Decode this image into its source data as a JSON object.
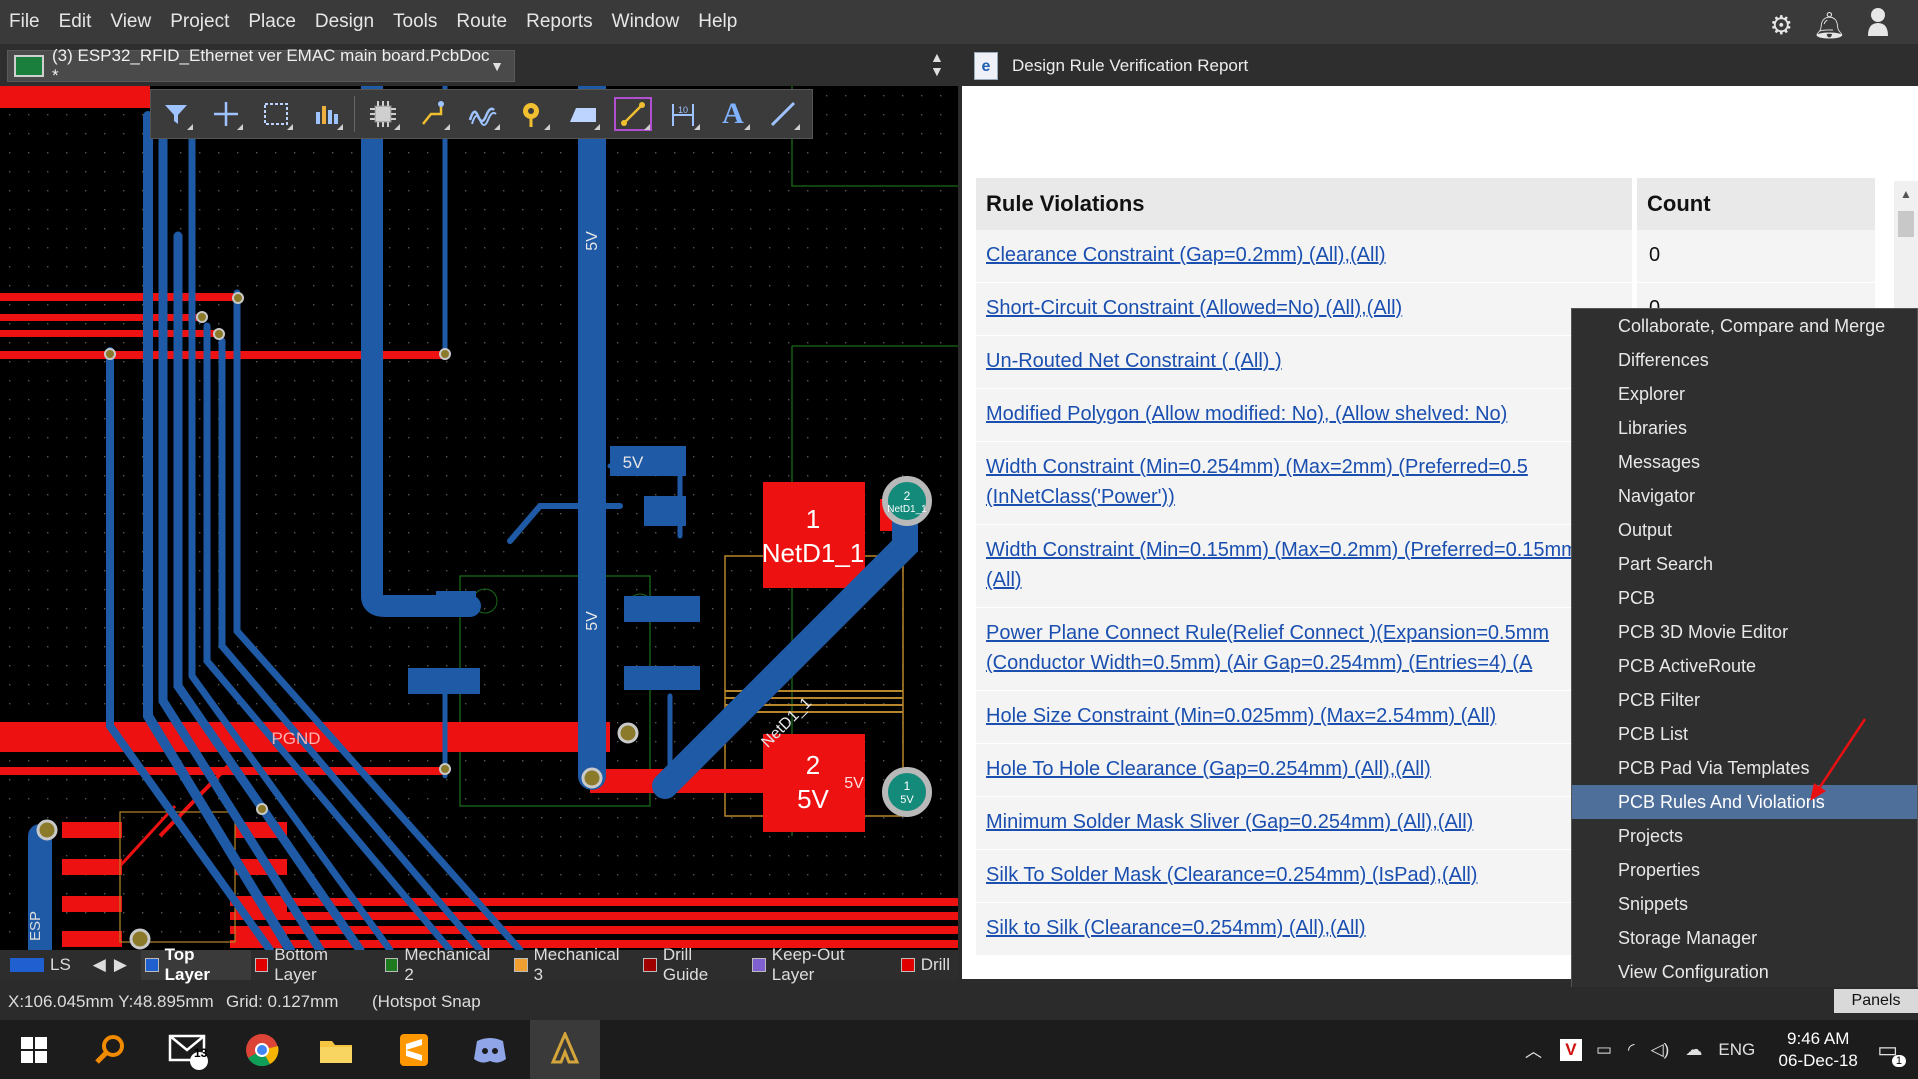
{
  "menubar": {
    "items": [
      "File",
      "Edit",
      "View",
      "Project",
      "Place",
      "Design",
      "Tools",
      "Route",
      "Reports",
      "Window",
      "Help"
    ]
  },
  "top_right_icons": [
    "gear-icon",
    "bell-icon",
    "user-icon"
  ],
  "doc_tab": {
    "title": "(3) ESP32_RFID_Ethernet ver EMAC main board.PcbDoc *"
  },
  "report_tab": {
    "title": "Design Rule Verification Report"
  },
  "pcb": {
    "labels": {
      "five_v_1": "5V",
      "five_v_2": "5V",
      "five_v_3": "5V",
      "pad1_num": "1",
      "pad1_net": "NetD1_1",
      "pad2_num": "2",
      "pad2_net": "5V",
      "via1_num": "2",
      "via1_net": "NetD1_1",
      "via2_num": "1",
      "via2_net": "5V",
      "trace_net": "NetD1_1",
      "pgnd": "PGND",
      "five_v_side": "5V",
      "esp": "ESP"
    }
  },
  "toolbar": {
    "tools": [
      "filter-icon",
      "cross-probe-icon",
      "select-region-icon",
      "chart-icon",
      "component-icon",
      "route-icon",
      "diff-pair-icon",
      "pad-via-icon",
      "polygon-icon",
      "interactive-length-icon",
      "dimension-icon",
      "text-icon",
      "line-icon"
    ]
  },
  "report": {
    "headers": {
      "rule": "Rule Violations",
      "count": "Count"
    },
    "rows": [
      {
        "rule": "Clearance Constraint (Gap=0.2mm) (All),(All)",
        "count": "0"
      },
      {
        "rule": "Short-Circuit Constraint (Allowed=No) (All),(All)",
        "count": "0"
      },
      {
        "rule": "Un-Routed Net Constraint ( (All) )",
        "count": ""
      },
      {
        "rule": "Modified Polygon (Allow modified: No), (Allow shelved: No)",
        "count": ""
      },
      {
        "rule": "Width Constraint (Min=0.254mm) (Max=2mm) (Preferred=0.5 (InNetClass('Power'))",
        "count": ""
      },
      {
        "rule": "Width Constraint (Min=0.15mm) (Max=0.2mm) (Preferred=0.15mm) (All)",
        "count": ""
      },
      {
        "rule": "Power Plane Connect Rule(Relief Connect )(Expansion=0.5mm (Conductor Width=0.5mm) (Air Gap=0.254mm) (Entries=4) (A",
        "count": ""
      },
      {
        "rule": "Hole Size Constraint (Min=0.025mm) (Max=2.54mm) (All)",
        "count": ""
      },
      {
        "rule": "Hole To Hole Clearance (Gap=0.254mm) (All),(All)",
        "count": ""
      },
      {
        "rule": "Minimum Solder Mask Sliver (Gap=0.254mm) (All),(All)",
        "count": ""
      },
      {
        "rule": "Silk To Solder Mask (Clearance=0.254mm) (IsPad),(All)",
        "count": ""
      },
      {
        "rule": "Silk to Silk (Clearance=0.254mm) (All),(All)",
        "count": ""
      }
    ]
  },
  "panels_menu": {
    "items": [
      "Collaborate, Compare and Merge",
      "Differences",
      "Explorer",
      "Libraries",
      "Messages",
      "Navigator",
      "Output",
      "Part Search",
      "PCB",
      "PCB 3D Movie Editor",
      "PCB ActiveRoute",
      "PCB Filter",
      "PCB List",
      "PCB Pad Via Templates",
      "PCB Rules And Violations",
      "Projects",
      "Properties",
      "Snippets",
      "Storage Manager",
      "View Configuration"
    ],
    "selected": "PCB Rules And Violations"
  },
  "layers": {
    "ls": "LS",
    "tabs": [
      {
        "name": "Top Layer",
        "color": "#1f5fd0"
      },
      {
        "name": "Bottom Layer",
        "color": "#e00000"
      },
      {
        "name": "Mechanical 2",
        "color": "#1e7a1e"
      },
      {
        "name": "Mechanical 3",
        "color": "#f0a030"
      },
      {
        "name": "Drill Guide",
        "color": "#a00000"
      },
      {
        "name": "Keep-Out Layer",
        "color": "#8060d0"
      },
      {
        "name": "Drill",
        "color": "#e00000"
      }
    ]
  },
  "status": {
    "coords": "X:106.045mm Y:48.895mm",
    "grid": "Grid: 0.127mm",
    "snap": "(Hotspot Snap",
    "panels_button": "Panels"
  },
  "taskbar": {
    "apps": [
      "windows-start-icon",
      "search-icon",
      "mail-icon",
      "chrome-icon",
      "file-explorer-icon",
      "sublime-icon",
      "discord-icon",
      "altium-icon"
    ],
    "mail_badge": "13",
    "tray": {
      "lang": "ENG",
      "time": "9:46 AM",
      "date": "06-Dec-18",
      "notif": "1"
    }
  }
}
